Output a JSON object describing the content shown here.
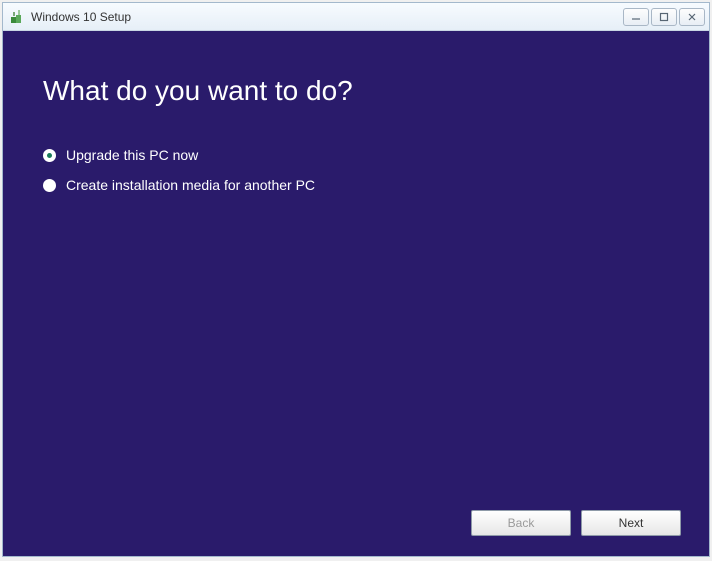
{
  "titlebar": {
    "title": "Windows 10 Setup"
  },
  "main": {
    "heading": "What do you want to do?",
    "options": [
      {
        "label": "Upgrade this PC now",
        "selected": true
      },
      {
        "label": "Create installation media for another PC",
        "selected": false
      }
    ]
  },
  "footer": {
    "back_label": "Back",
    "next_label": "Next"
  }
}
